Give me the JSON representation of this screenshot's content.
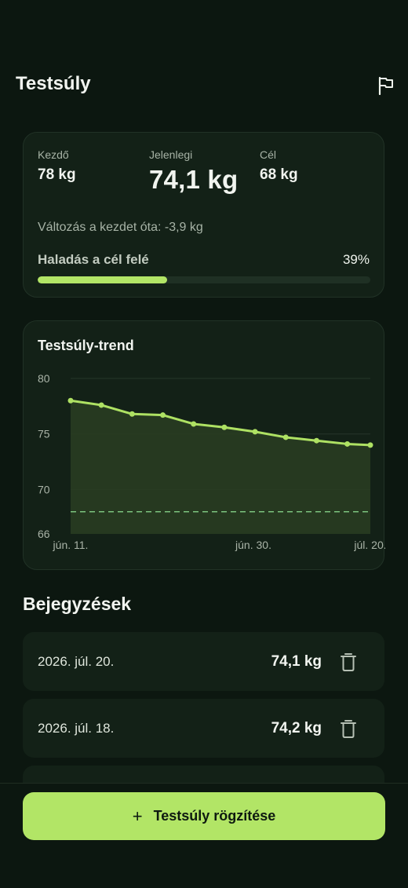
{
  "header": {
    "title": "Testsúly",
    "flag_icon": "flag-icon"
  },
  "summary": {
    "start_label": "Kezdő",
    "start_value": "78 kg",
    "current_label": "Jelenlegi",
    "current_value": "74,1 kg",
    "goal_label": "Cél",
    "goal_value": "68 kg",
    "change_text": "Változás a kezdet óta: -3,9 kg",
    "progress_label": "Haladás a cél felé",
    "progress_percent_text": "39%",
    "progress_fraction": 0.39
  },
  "chart": {
    "title": "Testsúly-trend",
    "chart_data": {
      "type": "area",
      "title": "Testsúly-trend",
      "ylim": [
        66,
        80
      ],
      "yticks": [
        80,
        75,
        70,
        66
      ],
      "x_tick_labels": [
        "jún. 11.",
        "jún. 30.",
        "júl. 20."
      ],
      "x_day_range": [
        11,
        50
      ],
      "goal_line": 68,
      "series": [
        {
          "x_day": [
            11,
            15,
            19,
            23,
            27,
            31,
            35,
            39,
            43,
            47,
            50
          ],
          "values": [
            78.0,
            77.6,
            76.8,
            76.7,
            75.9,
            75.6,
            75.2,
            74.7,
            74.4,
            74.1,
            74.0
          ]
        }
      ],
      "grid": true,
      "colors": {
        "line": "#aee163",
        "goal": "#7cc47e",
        "fill": "#2a3d22"
      }
    }
  },
  "entries_title": "Bejegyzések",
  "entries": [
    {
      "date": "2026. júl. 20.",
      "weight": "74,1 kg"
    },
    {
      "date": "2026. júl. 18.",
      "weight": "74,2 kg"
    }
  ],
  "add_button": {
    "icon": "plus-icon",
    "label": "Testsúly rögzítése"
  },
  "colors": {
    "accent": "#b2e566",
    "background": "#0c1710",
    "card": "#132117"
  }
}
